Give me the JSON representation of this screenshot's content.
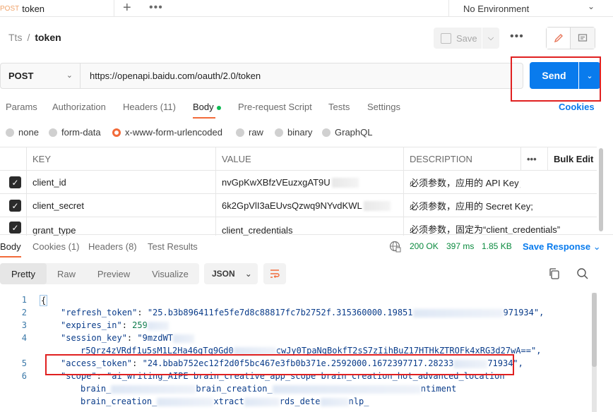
{
  "tabbar": {
    "active_tab": {
      "method": "POST",
      "name": "token"
    },
    "environment": "No Environment"
  },
  "breadcrumb": {
    "collection": "Tts",
    "separator": "/",
    "request": "token"
  },
  "toolbar": {
    "save_label": "Save"
  },
  "request": {
    "method": "POST",
    "url": "https://openapi.baidu.com/oauth/2.0/token",
    "send_label": "Send",
    "cookies_label": "Cookies"
  },
  "request_tabs": [
    "Params",
    "Authorization",
    "Headers (11)",
    "Body",
    "Pre-request Script",
    "Tests",
    "Settings"
  ],
  "body_types": [
    "none",
    "form-data",
    "x-www-form-urlencoded",
    "raw",
    "binary",
    "GraphQL"
  ],
  "params_table": {
    "headers": {
      "key": "KEY",
      "value": "VALUE",
      "description": "DESCRIPTION",
      "bulk_edit": "Bulk Edit"
    },
    "rows": [
      {
        "key": "client_id",
        "value": "nvGpKwXBfzVEuzxgAT9U",
        "description": "必须参数，应用的 API Key；"
      },
      {
        "key": "client_secret",
        "value": "6k2GpVlI3aEUvsQzwq9NYvdKWL",
        "description": "必须参数，应用的 Secret Key;"
      },
      {
        "key": "grant_type",
        "value": "client_credentials",
        "description": "必须参数，固定为“client_credentials”"
      }
    ]
  },
  "response": {
    "tabs": [
      "Body",
      "Cookies (1)",
      "Headers (8)",
      "Test Results"
    ],
    "status": "200 OK",
    "time": "397 ms",
    "size": "1.85 KB",
    "save_label": "Save Response",
    "views": [
      "Pretty",
      "Raw",
      "Preview",
      "Visualize"
    ],
    "format": "JSON"
  },
  "code_lines": {
    "l1": "{",
    "l2_key": "\"refresh_token\"",
    "l2_val_a": "\"25.b3b896411fe5fe7d8c88817fc7b2752f.315360000.19851",
    "l2_val_b": "971934\",",
    "l3_key": "\"expires_in\"",
    "l3_val": "259",
    "l4_key": "\"session_key\"",
    "l4_val": "\"9mzdWT",
    "l4b_a": "r5Qrz4zVRdf1u5sM1L2Ha46gTq9Gd0",
    "l4b_b": "cwJy0TpaNgBokfT2sS7zIihBuZ17HTHkZTROFk4xRG3d27wA==\",",
    "l5_key": "\"access_token\"",
    "l5_val_a": "\"24.bbab752ec12f2d0f5bc467e3fb0b371e.2592000.1672397717.28233",
    "l5_val_b": "71934\",",
    "l6_key": "\"scope\"",
    "l6_val": "\"ai_writing_AIPE brain_creative_app_scope brain_creation_hot_advanced_location",
    "l6b_a": "brain_",
    "l6b_b": "brain_creation_",
    "l6b_c": "ntiment",
    "l6c_a": "brain_creation_",
    "l6c_b": "xtract",
    "l6c_c": "rds_dete",
    "l6c_d": "nlp_"
  },
  "line_numbers": [
    "1",
    "2",
    "3",
    "4",
    "5",
    "6"
  ]
}
